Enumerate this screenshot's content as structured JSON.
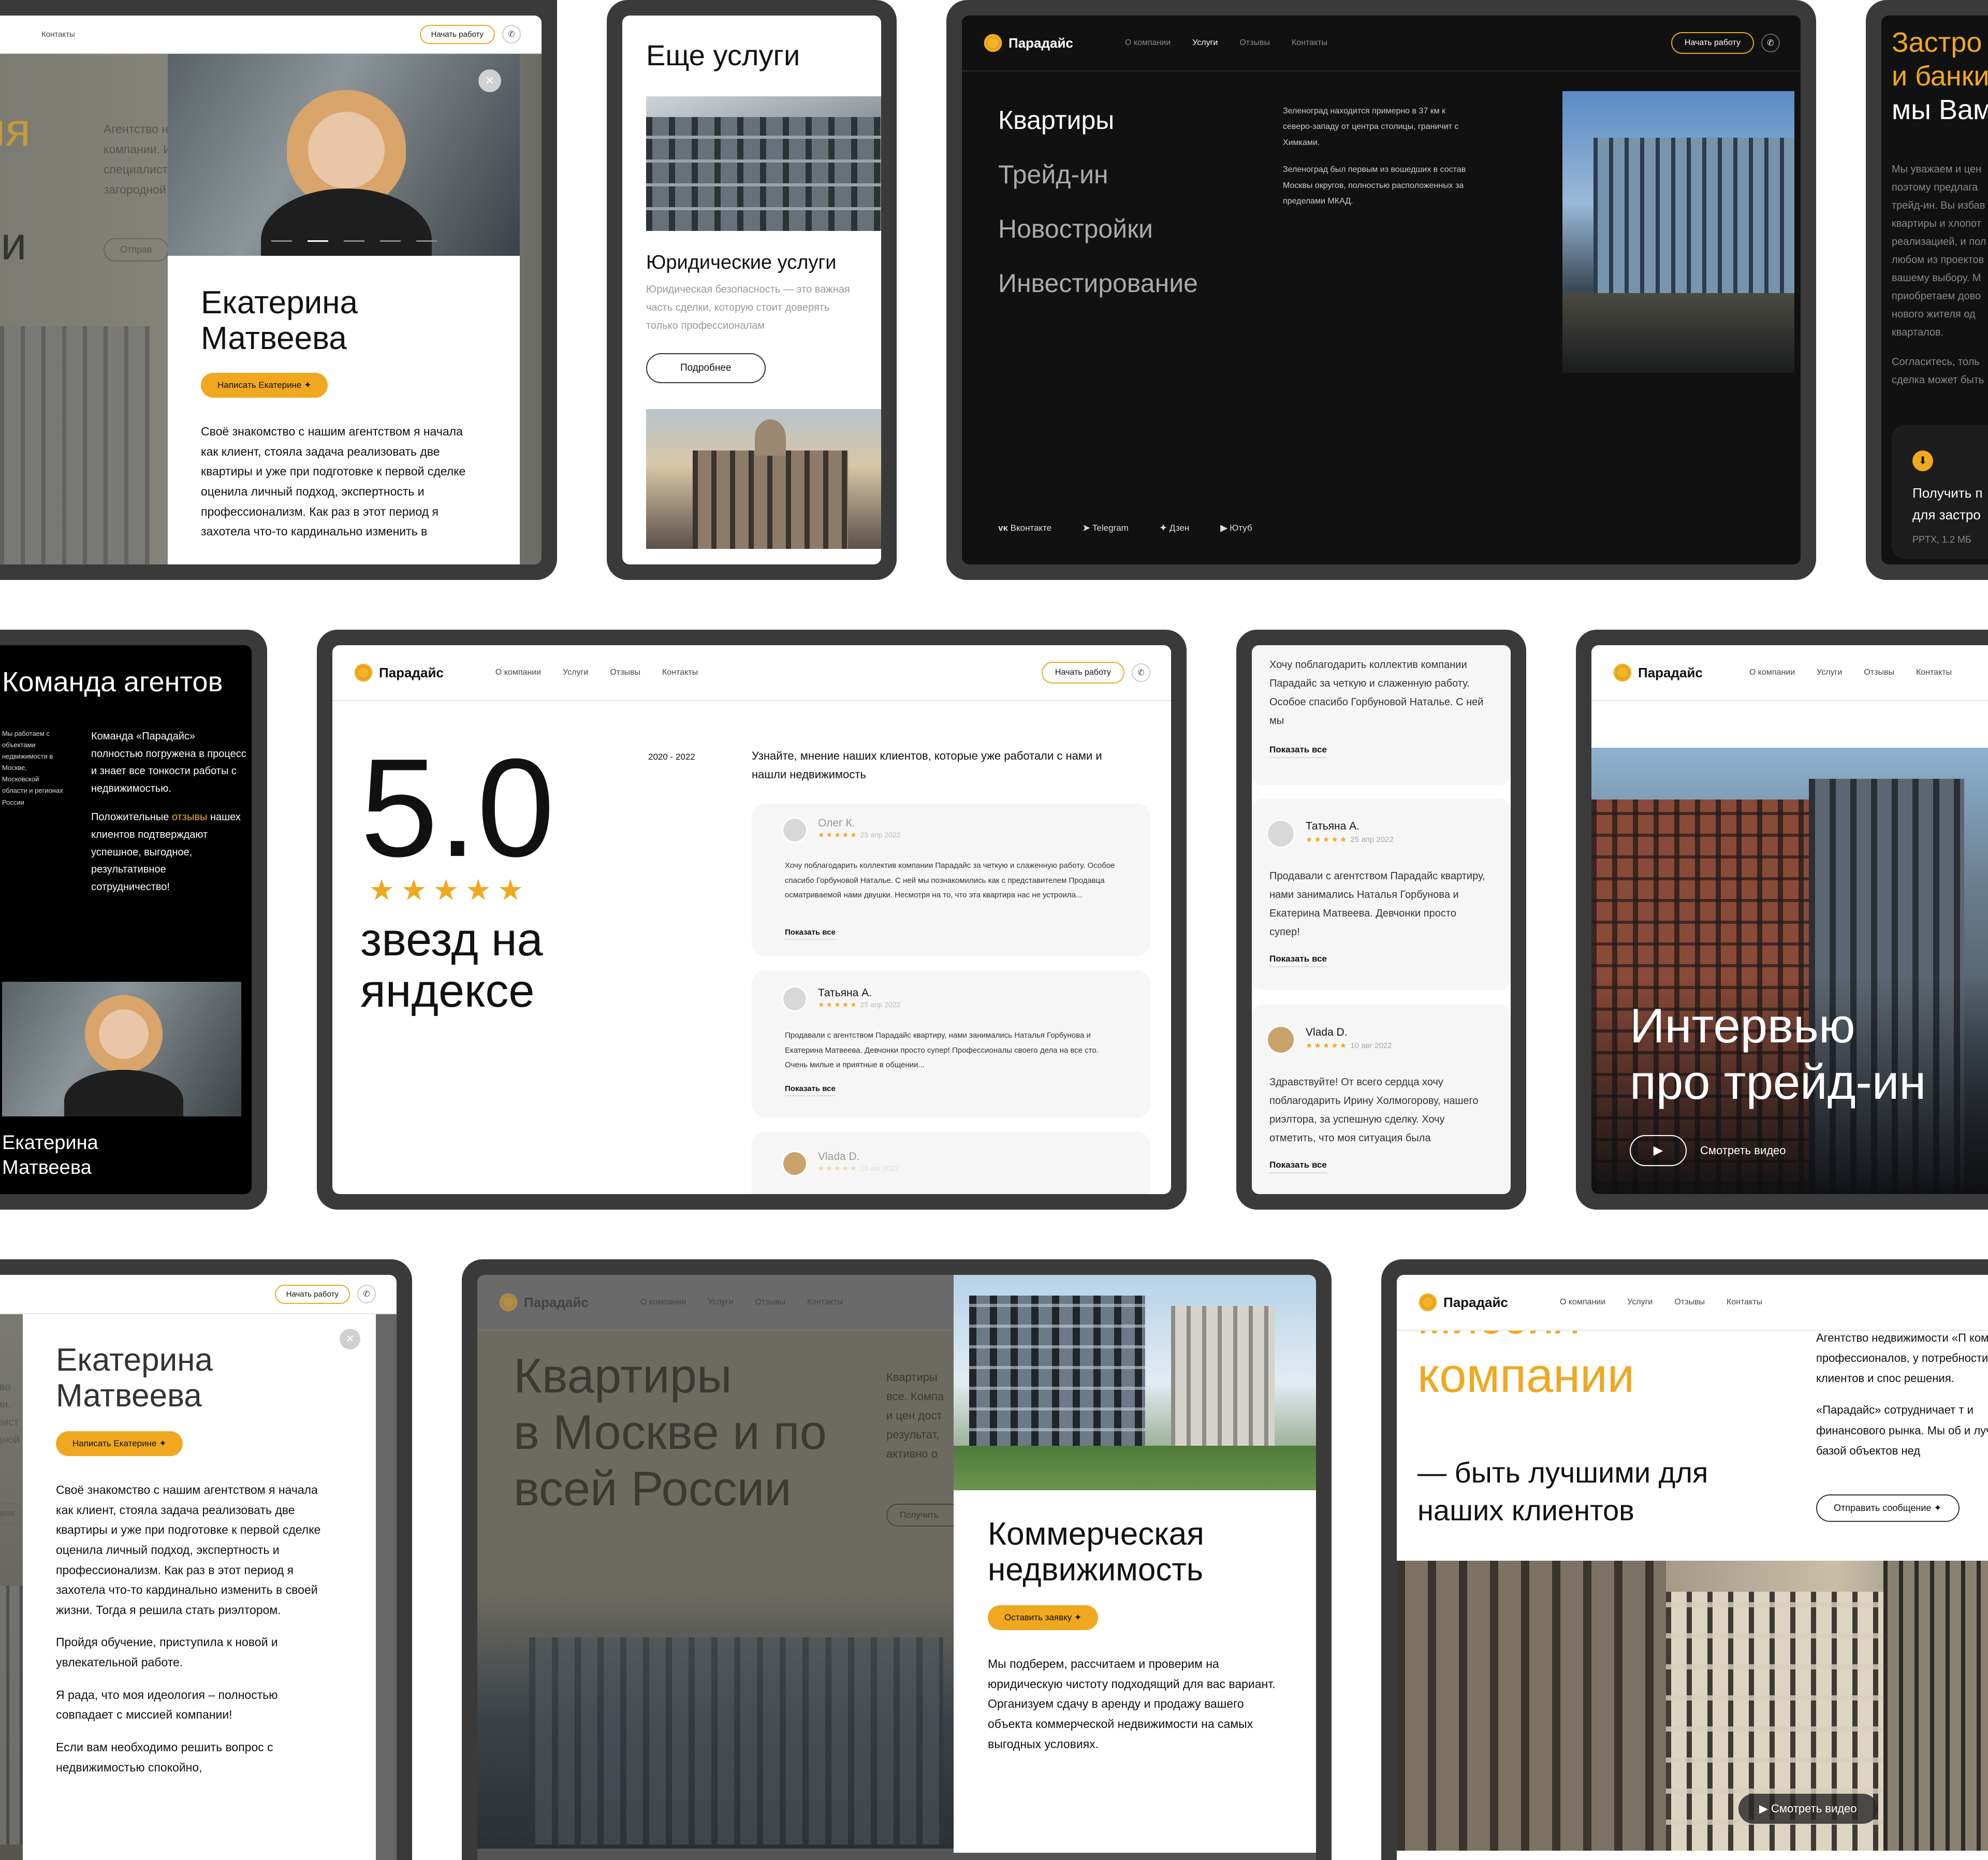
{
  "brand": "Парадайс",
  "nav": {
    "about": "О компании",
    "services": "Услуги",
    "reviews": "Отзывы",
    "contacts": "Контакты",
    "contacts_partial": "Контакты",
    "start": "Начать работу",
    "phone_icon": "phone-icon"
  },
  "colors": {
    "accent": "#f0a820",
    "dark": "#111111",
    "device": "#3a3a3a"
  },
  "p1": {
    "partial_heading_1": "ия",
    "partial_heading_2": "ти",
    "partial_text": [
      "Агентство н",
      "компании. И",
      "специалист",
      "загородной"
    ],
    "partial_btn": "Отправ",
    "name": "Екатерина\nМатвеева",
    "write_btn": "Написать Екатерине",
    "bio": "Своё знакомство с нашим агентством я начала как клиент, стояла задача реализовать две квартиры и уже при подготовке к первой сделке оценила личный подход, экспертность и профессионализм. Как раз в этот период я захотела что-то кардинально изменить в"
  },
  "p2": {
    "title": "Еще услуги",
    "service_title": "Юридические услуги",
    "service_desc": "Юридическая безопасность — это важная часть сделки, которую стоит доверять только профессионалам",
    "more_btn": "Подробнее"
  },
  "p3": {
    "menu": [
      "Квартиры",
      "Трейд-ин",
      "Новостройки",
      "Инвестирование"
    ],
    "text1": "Зеленоград находится примерно в 37 км к северо-западу от центра столицы, граничит с Химками.",
    "text2": "Зеленоград был первым из вошедших в состав Москвы округов, полностью расположенных за пределами МКАД.",
    "socials": [
      "Вконтакте",
      "Telegram",
      "Дзен",
      "Ютуб"
    ]
  },
  "p4": {
    "heading": [
      "Застро",
      "и банки",
      "мы Вам"
    ],
    "text": [
      "Мы уважаем и цен",
      "поэтому предлага",
      "трейд-ин. Вы избав",
      "квартиры и хлопот",
      "реализацией, и пол",
      "любом из проектов",
      "вашему выбору. М",
      "приобретаем дово",
      "нового жителя од",
      "кварталов."
    ],
    "text2": [
      "Согласитесь, толь",
      "сделка может быть"
    ],
    "download": "Получить п\nдля застро",
    "file": "PPTX, 1.2 МБ"
  },
  "p5": {
    "title": "Команда агентов",
    "side": "Мы работаем с объектами недвижимости в Москве, Московской области и регионах России",
    "main": "Команда «Парадайс» полностью погружена в процесс и знает все тонкости работы с недвижимостью.",
    "pos_1": "Положительные",
    "pos_link": "отзывы",
    "pos_2": "нашех клиентов подтверждают успешное, выгодное, результативное сотрудничество!",
    "name": "Екатерина\nМатвеева"
  },
  "p6": {
    "rating": "5.0",
    "stars": "★★★★★",
    "caption": "звезд на\nяндексе",
    "years": "2020 - 2022",
    "intro": "Узнайте, мнение наших клиентов, которые уже работали с нами и нашли недвижимость",
    "reviews": [
      {
        "name": "Олег К.",
        "date": "25 апр 2022",
        "text": "Хочу поблагодарить коллектив компании Парадайс за четкую и слаженную работу. Особое спасибо Горбуновой Наталье. С ней мы познакомились как с представителем Продавца осматриваемой нами двушки. Несмотря на то, что эта квартира нас не устроила...",
        "more": "Показать все"
      },
      {
        "name": "Татьяна А.",
        "date": "25 апр 2022",
        "text": "Продавали с агентством Парадайс квартиру, нами занимались Наталья Горбунова и Екатерина Матвеева. Девчонки просто супер! Профессионалы своего дела на все сто. Очень милые и приятные в общении...",
        "more": "Показать все"
      },
      {
        "name": "Vlada D.",
        "date": "10 авг 2022"
      }
    ]
  },
  "p7": {
    "reviews": [
      {
        "text": "Хочу поблагодарить коллектив компании Парадайс за четкую и слаженную работу. Особое спасибо Горбуновой Наталье. С ней мы",
        "more": "Показать все"
      },
      {
        "name": "Татьяна А.",
        "date": "25 апр 2022",
        "text": "Продавали с агентством Парадайс квартиру, нами занимались Наталья Горбунова и Екатерина Матвеева. Девчонки просто супер!",
        "more": "Показать все"
      },
      {
        "name": "Vlada D.",
        "date": "10 авг 2022",
        "text": "Здравствуйте! От всего сердца хочу поблагодарить Ирину Холмогорову, нашего риэлтора, за успешную сделку. Хочу отметить, что моя ситуация была",
        "more": "Показать все"
      }
    ]
  },
  "p8": {
    "title": "Интервью\nпро трейд-ин",
    "video": "Смотреть видео",
    "nav_partial": [
      "О компании",
      "Услуги",
      "Отзывы",
      "Контакты"
    ]
  },
  "p9": {
    "partial": [
      "нтство",
      "пании.",
      "циалист",
      "ородной"
    ],
    "partial_btn": "Отправ",
    "name": "Екатерина\nМатвеева",
    "write_btn": "Написать Екатерине",
    "bio": [
      "Своё знакомство с нашим агентством я начала как клиент, стояла задача реализовать две квартиры и уже при подготовке к первой сделке оценила личный подход, экспертность и профессионализм. Как раз в этот период я захотела что-то кардинально изменить в своей жизни. Тогда я решила стать риэлтором.",
      "Пройдя обучение, приступила к новой и увлекательной работе.",
      "Я рада, что моя идеология – полностью совпадает с миссией компании!",
      "Если вам необходимо решить вопрос с недвижимостью спокойно,"
    ]
  },
  "p10": {
    "heading": "Квартиры\nв Москве и по\nвсей России",
    "side": [
      "Квартиры",
      "все. Компа",
      "и цен дост",
      "результат,",
      "активно о"
    ],
    "side_btn": "Получить",
    "title": "Коммерческая\nнедвижимость",
    "btn": "Оставить заявку",
    "text": "Мы подберем, рассчитаем и проверим на юридическую чистоту подходящий для вас вариант. Организуем сдачу в аренду и продажу вашего объекта коммерческой недвижимости на самых выгодных условиях."
  },
  "p11": {
    "heading_partial": "миссия",
    "heading": "компании",
    "sub": "— быть лучшими для\nнаших клиентов",
    "text1": "Агентство недвижимости «П команда профессионалов, у потребности клиентов и спос решения.",
    "text2": "«Парадайс» сотрудничает т и финансового рынка. Мы об и лучшей базой объектов нед",
    "send_btn": "Отправить сообщение",
    "video": "Смотреть видео"
  }
}
